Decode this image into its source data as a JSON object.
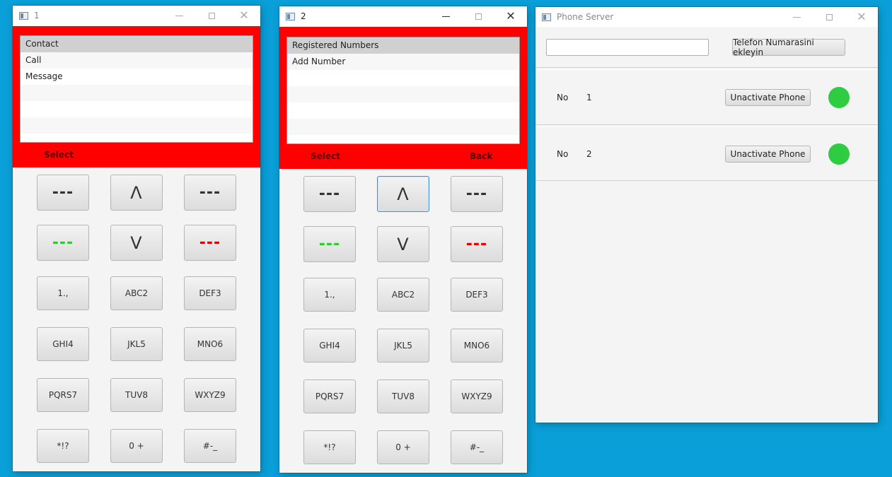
{
  "phone1": {
    "title": "1",
    "list": [
      "Contact",
      "Call",
      "Message"
    ],
    "softkey_left": "Select",
    "softkey_right": ""
  },
  "phone2": {
    "title": "2",
    "list": [
      "Registered Numbers",
      "Add Number"
    ],
    "softkey_left": "Select",
    "softkey_right": "Back"
  },
  "keypad": {
    "nav_left": "---",
    "up": "Λ",
    "nav_right": "---",
    "call": "---",
    "down": "V",
    "end": "---",
    "k1": "1.,",
    "k2": "ABC2",
    "k3": "DEF3",
    "k4": "GHI4",
    "k5": "JKL5",
    "k6": "MNO6",
    "k7": "PQRS7",
    "k8": "TUV8",
    "k9": "WXYZ9",
    "kstar": "*!?",
    "k0": "0 +",
    "khash": "#-_"
  },
  "server": {
    "title": "Phone Server",
    "input_value": "",
    "add_button": "Telefon Numarasini ekleyin",
    "rows": [
      {
        "label": "No",
        "number": "1",
        "button": "Unactivate Phone",
        "status_color": "#2ecc40"
      },
      {
        "label": "No",
        "number": "2",
        "button": "Unactivate Phone",
        "status_color": "#2ecc40"
      }
    ]
  },
  "colors": {
    "desktop": "#0a9fd8",
    "screen": "#ff0000",
    "green": "#2ecc2e",
    "red": "#e00000"
  }
}
